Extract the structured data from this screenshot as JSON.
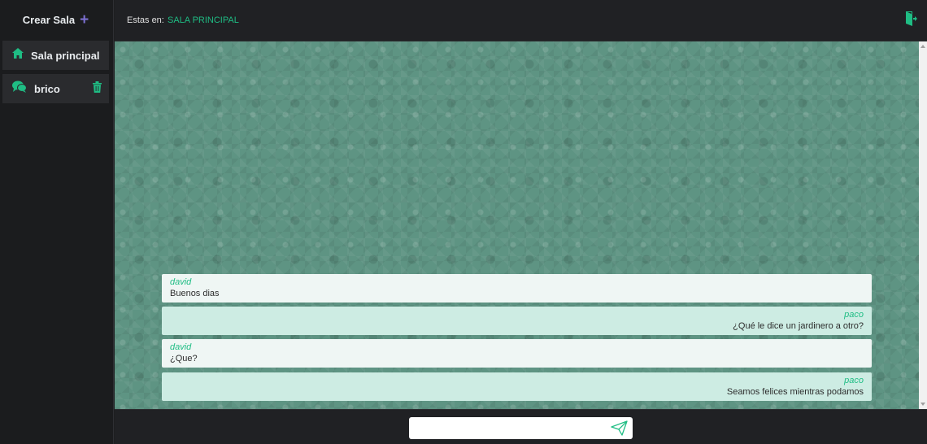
{
  "sidebar": {
    "create_label": "Crear Sala",
    "create_icon": "plus-icon",
    "rooms": [
      {
        "label": "Sala principal",
        "icon": "home-icon"
      },
      {
        "label": "brico",
        "icon": "chat-bubbles-icon",
        "action_icon": "trash-icon"
      }
    ]
  },
  "header": {
    "prefix": "Estas en:",
    "room_title": "SALA PRINCIPAL",
    "exit_icon": "logout-icon"
  },
  "messages": [
    {
      "author": "david",
      "text": "Buenos dias",
      "side": "left"
    },
    {
      "author": "paco",
      "text": "¿Qué le dice un jardinero a otro?",
      "side": "right"
    },
    {
      "author": "david",
      "text": "¿Que?",
      "side": "left"
    },
    {
      "author": "paco",
      "text": "Seamos felices mientras podamos",
      "side": "right"
    }
  ],
  "composer": {
    "value": "",
    "placeholder": "",
    "send_icon": "send-icon"
  },
  "colors": {
    "accent": "#1fbd84",
    "create_plus": "#7b6fd0",
    "chat_background": "#5e9483",
    "message_other": "#eff6f4",
    "message_me": "#cdece3",
    "sidebar": "#1b1c1e",
    "room_item": "#2a2b2e"
  }
}
